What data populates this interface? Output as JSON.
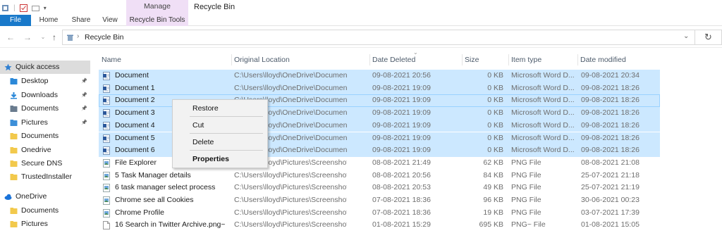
{
  "window": {
    "title": "Recycle Bin",
    "contextual_tab_group": "Manage"
  },
  "ribbon": {
    "tabs": [
      {
        "label": "File"
      },
      {
        "label": "Home"
      },
      {
        "label": "Share"
      },
      {
        "label": "View"
      },
      {
        "label": "Recycle Bin Tools"
      }
    ]
  },
  "address": {
    "path": "Recycle Bin"
  },
  "nav": {
    "items": [
      {
        "label": "Quick access",
        "icon": "star-icon",
        "color": "#2f7fd1"
      },
      {
        "label": "Desktop",
        "icon": "desktop-folder-icon",
        "color": "#2b88d8",
        "pinned": true
      },
      {
        "label": "Downloads",
        "icon": "download-icon",
        "color": "#2b88d8",
        "pinned": true
      },
      {
        "label": "Documents",
        "icon": "documents-folder-icon",
        "color": "#6a7c8f",
        "pinned": true
      },
      {
        "label": "Pictures",
        "icon": "pictures-folder-icon",
        "color": "#3c8fd8",
        "pinned": true
      },
      {
        "label": "Documents",
        "icon": "folder-icon",
        "color": "#f2c94c"
      },
      {
        "label": "Onedrive",
        "icon": "folder-icon",
        "color": "#f2c94c"
      },
      {
        "label": "Secure DNS",
        "icon": "folder-icon",
        "color": "#f2c94c"
      },
      {
        "label": "TrustedInstaller",
        "icon": "folder-icon",
        "color": "#f2c94c"
      },
      {
        "label": "OneDrive",
        "icon": "cloud-icon",
        "color": "#1a73d9"
      },
      {
        "label": "Documents",
        "icon": "folder-icon",
        "color": "#f2c94c"
      },
      {
        "label": "Pictures",
        "icon": "folder-icon",
        "color": "#f2c94c"
      }
    ]
  },
  "columns": [
    "Name",
    "Original Location",
    "Date Deleted",
    "Size",
    "Item type",
    "Date modified"
  ],
  "files": [
    {
      "name": "Document",
      "location": "C:\\Users\\lloyd\\OneDrive\\Documents",
      "deleted": "09-08-2021 20:56",
      "size": "0 KB",
      "type": "Microsoft Word D...",
      "modified": "09-08-2021 20:34",
      "icon": "word-doc-icon",
      "selected": true
    },
    {
      "name": "Document 1",
      "location": "C:\\Users\\lloyd\\OneDrive\\Documents",
      "deleted": "09-08-2021 19:09",
      "size": "0 KB",
      "type": "Microsoft Word D...",
      "modified": "09-08-2021 18:26",
      "icon": "word-doc-icon",
      "selected": true
    },
    {
      "name": "Document 2",
      "location": "C:\\Users\\lloyd\\OneDrive\\Documents",
      "deleted": "09-08-2021 19:09",
      "size": "0 KB",
      "type": "Microsoft Word D...",
      "modified": "09-08-2021 18:26",
      "icon": "word-doc-icon",
      "selected": true,
      "focused": true
    },
    {
      "name": "Document 3",
      "location": "C:\\Users\\lloyd\\OneDrive\\Documents",
      "deleted": "09-08-2021 19:09",
      "size": "0 KB",
      "type": "Microsoft Word D...",
      "modified": "09-08-2021 18:26",
      "icon": "word-doc-icon",
      "selected": true
    },
    {
      "name": "Document 4",
      "location": "C:\\Users\\lloyd\\OneDrive\\Documents",
      "deleted": "09-08-2021 19:09",
      "size": "0 KB",
      "type": "Microsoft Word D...",
      "modified": "09-08-2021 18:26",
      "icon": "word-doc-icon",
      "selected": true
    },
    {
      "name": "Document 5",
      "location": "C:\\Users\\lloyd\\OneDrive\\Documents",
      "deleted": "09-08-2021 19:09",
      "size": "0 KB",
      "type": "Microsoft Word D...",
      "modified": "09-08-2021 18:26",
      "icon": "word-doc-icon",
      "selected": true
    },
    {
      "name": "Document 6",
      "location": "C:\\Users\\lloyd\\OneDrive\\Documents",
      "deleted": "09-08-2021 19:09",
      "size": "0 KB",
      "type": "Microsoft Word D...",
      "modified": "09-08-2021 18:26",
      "icon": "word-doc-icon",
      "selected": true
    },
    {
      "name": "File Explorer",
      "location": "C:\\Users\\lloyd\\Pictures\\Screenshots\\Trust...",
      "deleted": "08-08-2021 21:49",
      "size": "62 KB",
      "type": "PNG File",
      "modified": "08-08-2021 21:08",
      "icon": "png-file-icon"
    },
    {
      "name": "5 Task Manager details",
      "location": "C:\\Users\\lloyd\\Pictures\\Screenshots\\Trust...",
      "deleted": "08-08-2021 20:56",
      "size": "84 KB",
      "type": "PNG File",
      "modified": "25-07-2021 21:18",
      "icon": "png-file-icon"
    },
    {
      "name": "6 task manager select process",
      "location": "C:\\Users\\lloyd\\Pictures\\Screenshots\\Trust...",
      "deleted": "08-08-2021 20:53",
      "size": "49 KB",
      "type": "PNG File",
      "modified": "25-07-2021 21:19",
      "icon": "png-file-icon"
    },
    {
      "name": "Chrome see all Cookies",
      "location": "C:\\Users\\lloyd\\Pictures\\Screenshots\\Secu...",
      "deleted": "07-08-2021 18:36",
      "size": "96 KB",
      "type": "PNG File",
      "modified": "30-06-2021 00:23",
      "icon": "png-file-icon"
    },
    {
      "name": "Chrome Profile",
      "location": "C:\\Users\\lloyd\\Pictures\\Screenshots\\Secu...",
      "deleted": "07-08-2021 18:36",
      "size": "19 KB",
      "type": "PNG File",
      "modified": "03-07-2021 17:39",
      "icon": "png-file-icon"
    },
    {
      "name": "16 Search in Twitter Archive.png~",
      "location": "C:\\Users\\lloyd\\Pictures\\Screenshots\\Dele...",
      "deleted": "01-08-2021 15:29",
      "size": "695 KB",
      "type": "PNG~ File",
      "modified": "01-08-2021 15:05",
      "icon": "generic-file-icon"
    }
  ],
  "context_menu": {
    "items": [
      "Restore",
      "Cut",
      "Delete",
      "Properties"
    ]
  },
  "colors": {
    "accent": "#1979ca",
    "selection": "#cce8ff",
    "contextual_tab": "#f0dff6"
  }
}
